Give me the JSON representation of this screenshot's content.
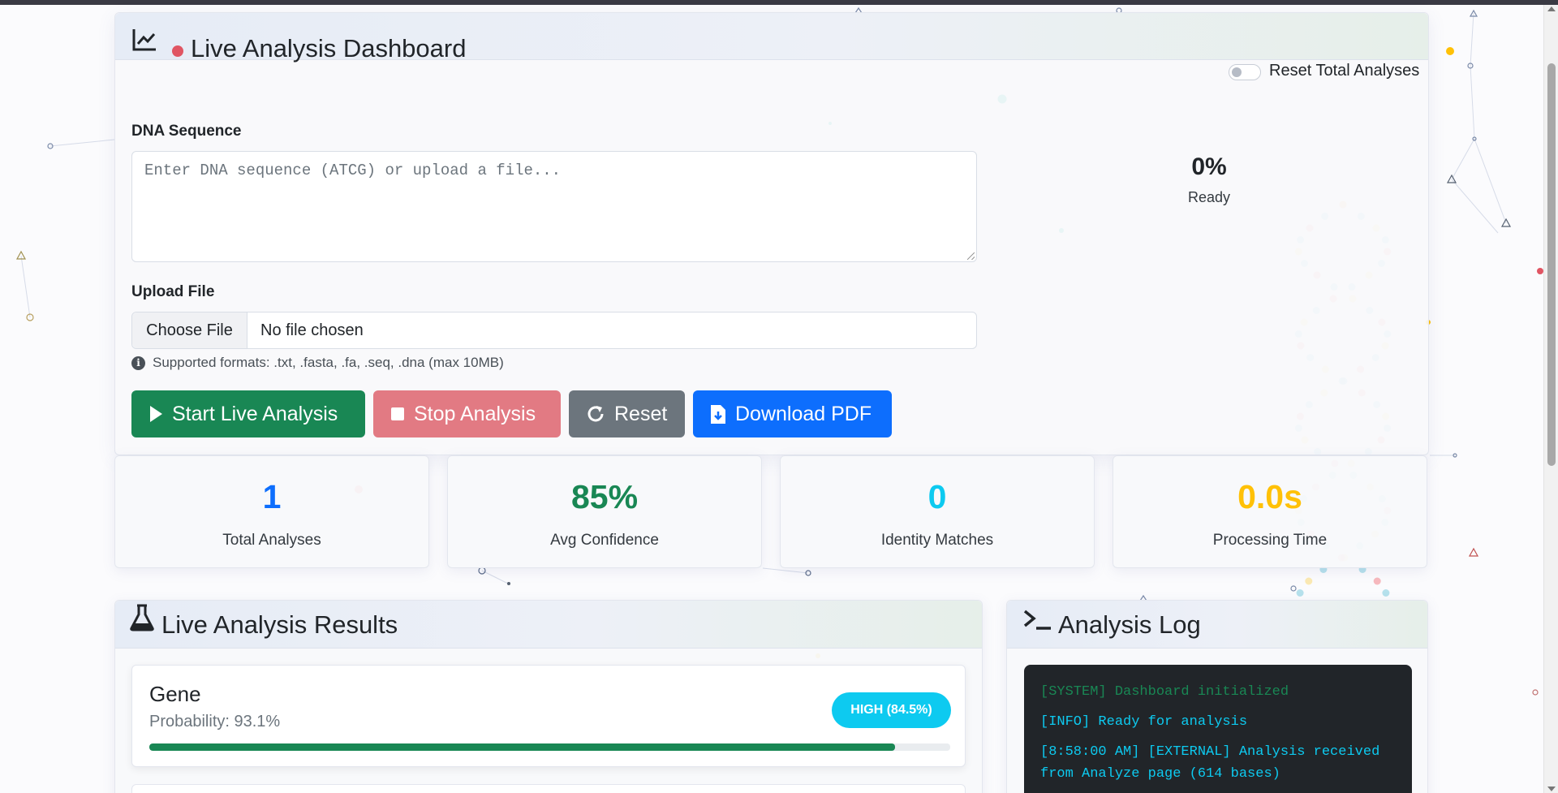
{
  "dashboard": {
    "title": "Live Analysis Dashboard",
    "reset_toggle_label": "Reset Total Analyses"
  },
  "form": {
    "sequence_label": "DNA Sequence",
    "sequence_placeholder": "Enter DNA sequence (ATCG) or upload a file...",
    "upload_label": "Upload File",
    "choose_file_label": "Choose File",
    "file_status": "No file chosen",
    "formats_hint": "Supported formats: .txt, .fasta, .fa, .seq, .dna (max 10MB)"
  },
  "buttons": {
    "start": "Start Live Analysis",
    "stop": "Stop Analysis",
    "reset": "Reset",
    "download": "Download PDF"
  },
  "progress": {
    "value": "0%",
    "status": "Ready"
  },
  "stats": [
    {
      "value": "1",
      "label": "Total Analyses",
      "color": "#0d6efd"
    },
    {
      "value": "85%",
      "label": "Avg Confidence",
      "color": "#198754"
    },
    {
      "value": "0",
      "label": "Identity Matches",
      "color": "#0dcaf0"
    },
    {
      "value": "0.0s",
      "label": "Processing Time",
      "color": "#ffc107"
    }
  ],
  "results": {
    "title": "Live Analysis Results",
    "items": [
      {
        "name": "Gene",
        "probability": "Probability: 93.1%",
        "badge": "HIGH (84.5%)",
        "fill": 0.931
      }
    ]
  },
  "log": {
    "title": "Analysis Log",
    "lines": [
      "[SYSTEM] Dashboard initialized",
      "[INFO] Ready for analysis",
      "[8:58:00 AM] [EXTERNAL] Analysis received from Analyze page (614 bases)"
    ]
  },
  "colors": {
    "success": "#198754",
    "danger": "#e27a83",
    "secondary": "#6c757d",
    "primary": "#0d6efd",
    "info": "#0dcaf0",
    "warning": "#ffc107"
  },
  "icons": [
    "chart-line-icon",
    "live-dot-icon",
    "info-icon",
    "play-icon",
    "stop-icon",
    "reset-icon",
    "file-download-icon",
    "flask-icon",
    "terminal-icon"
  ]
}
